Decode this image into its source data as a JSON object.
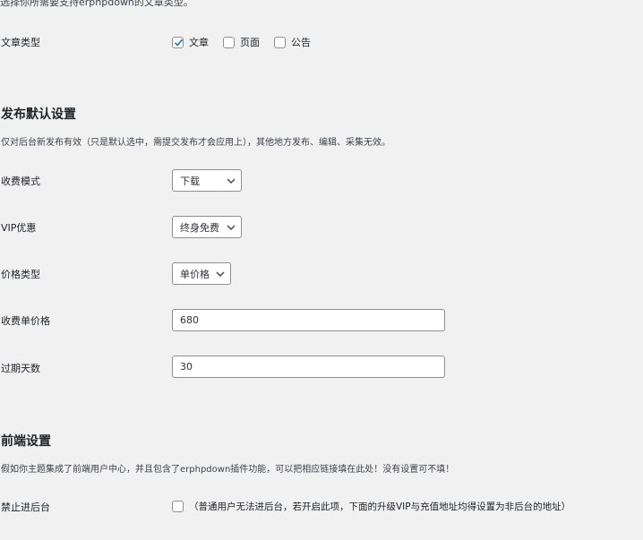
{
  "top_note": "选择你所需要支持erphpdown的文章类型。",
  "post_types": {
    "label": "文章类型",
    "options": [
      {
        "label": "文章",
        "checked": true
      },
      {
        "label": "页面",
        "checked": false
      },
      {
        "label": "公告",
        "checked": false
      }
    ]
  },
  "publish_defaults": {
    "title": "发布默认设置",
    "description": "仅对后台新发布有效（只是默认选中，需提交发布才会应用上），其他地方发布、编辑、采集无效。",
    "charge_mode": {
      "label": "收费模式",
      "value": "下载"
    },
    "vip_discount": {
      "label": "VIP优惠",
      "value": "终身免费"
    },
    "price_type": {
      "label": "价格类型",
      "value": "单价格"
    },
    "unit_price": {
      "label": "收费单价格",
      "value": "680"
    },
    "expire_days": {
      "label": "过期天数",
      "value": "30"
    }
  },
  "frontend": {
    "title": "前端设置",
    "description": "假如你主题集成了前端用户中心，并且包含了erphpdown插件功能，可以把相应链接填在此处！没有设置可不填！",
    "block_admin": {
      "label": "禁止进后台",
      "checked": false,
      "hint": "（普通用户无法进后台，若开启此项，下面的升级VIP与充值地址均得设置为非后台的地址）"
    }
  }
}
